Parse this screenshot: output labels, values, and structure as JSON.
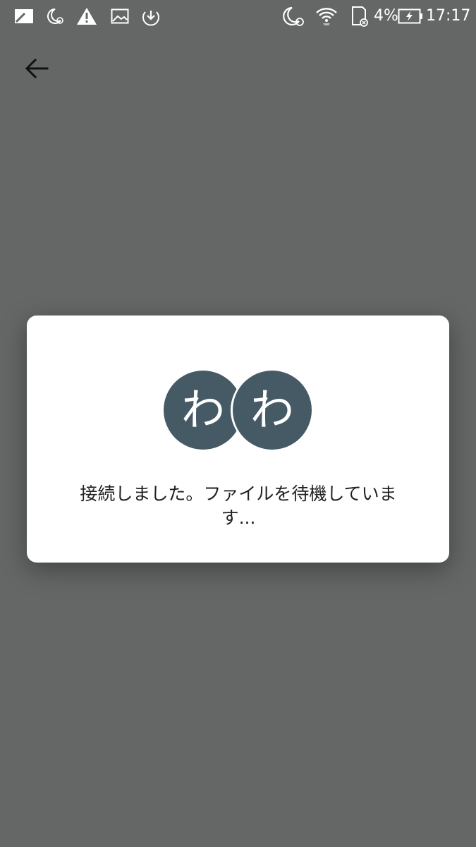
{
  "status_bar": {
    "battery_percent": "4%",
    "time": "17:17",
    "icons": [
      "notes-icon",
      "moon-alarm-icon",
      "warning-icon",
      "image-icon",
      "sync-download-icon",
      "moon-alarm-icon",
      "wifi-icon",
      "sd-card-icon",
      "battery-charging-icon"
    ]
  },
  "toolbar": {
    "back_icon": "arrow-left-icon"
  },
  "dialog": {
    "avatars": [
      {
        "initial": "わ"
      },
      {
        "initial": "わ"
      }
    ],
    "message": "接続しました。ファイルを待機しています..."
  },
  "colors": {
    "background": "#656766",
    "avatar": "#465a66",
    "dialog": "#ffffff"
  }
}
